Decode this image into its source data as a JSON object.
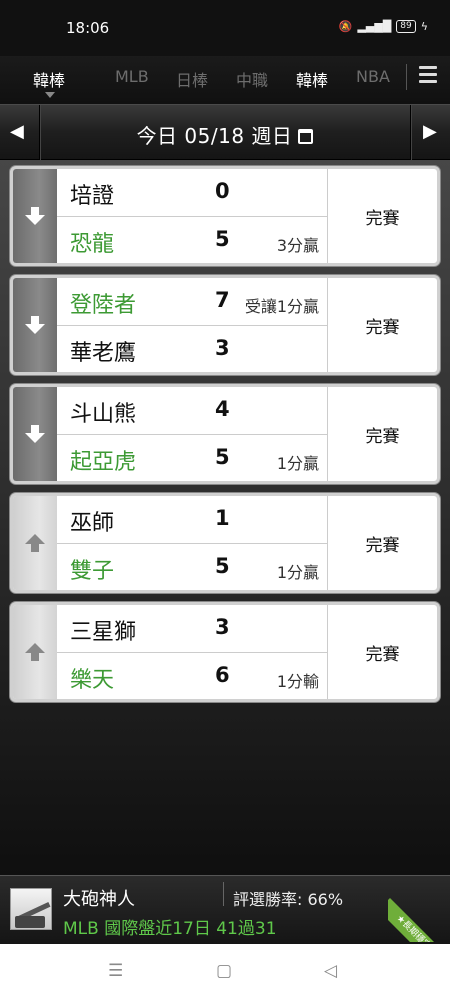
{
  "status_bar": {
    "time": "18:06",
    "battery": "89"
  },
  "tabs": [
    {
      "label": "韓棒",
      "active": true
    },
    {
      "label": "MLB",
      "active": false
    },
    {
      "label": "日棒",
      "active": false
    },
    {
      "label": "中職",
      "active": false
    },
    {
      "label": "韓棒",
      "active": false
    },
    {
      "label": "NBA",
      "active": false
    }
  ],
  "date_bar": {
    "date_label": "今日 05/18 週日"
  },
  "games": [
    {
      "direction": "down",
      "teams": [
        {
          "name": "培證",
          "score": "0",
          "note": "",
          "winner": false
        },
        {
          "name": "恐龍",
          "score": "5",
          "note": "3分贏",
          "winner": true
        }
      ],
      "status": "完賽"
    },
    {
      "direction": "down",
      "teams": [
        {
          "name": "登陸者",
          "score": "7",
          "note": "受讓1分贏",
          "winner": true
        },
        {
          "name": "華老鷹",
          "score": "3",
          "note": "",
          "winner": false
        }
      ],
      "status": "完賽"
    },
    {
      "direction": "down",
      "teams": [
        {
          "name": "斗山熊",
          "score": "4",
          "note": "",
          "winner": false
        },
        {
          "name": "起亞虎",
          "score": "5",
          "note": "1分贏",
          "winner": true
        }
      ],
      "status": "完賽"
    },
    {
      "direction": "up",
      "teams": [
        {
          "name": "巫師",
          "score": "1",
          "note": "",
          "winner": false
        },
        {
          "name": "雙子",
          "score": "5",
          "note": "1分贏",
          "winner": true
        }
      ],
      "status": "完賽"
    },
    {
      "direction": "up",
      "teams": [
        {
          "name": "三星獅",
          "score": "3",
          "note": "",
          "winner": false
        },
        {
          "name": "樂天",
          "score": "6",
          "note": "1分輸",
          "winner": true
        }
      ],
      "status": "完賽"
    }
  ],
  "banner": {
    "expert_name": "大砲神人",
    "win_rate": "評選勝率: 66%",
    "record": "MLB 國際盤近17日 41過31",
    "ribbon": "★長期穩定★"
  },
  "colors": {
    "win_green": "#3d9a34",
    "accent_green": "#5fc84a"
  },
  "icons": {
    "prev": "chevron-left-icon",
    "next": "chevron-right-icon",
    "calendar": "calendar-icon",
    "menu": "menu-icon"
  }
}
